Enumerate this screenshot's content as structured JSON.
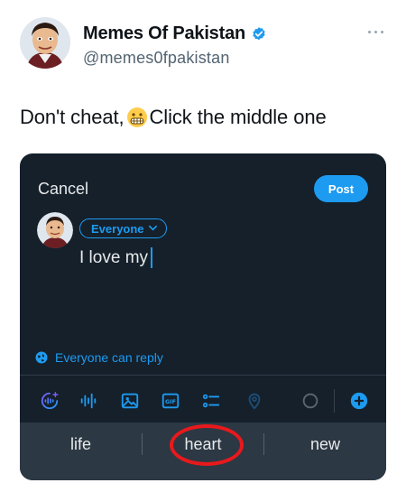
{
  "tweet": {
    "author_name": "Memes Of Pakistan",
    "author_handle": "@memes0fpakistan",
    "text_before_emoji": "Don't cheat,",
    "emoji_name": "grimacing-face-emoji",
    "text_after_emoji": "Click the middle one",
    "accent_color": "#1d9bf0"
  },
  "composer": {
    "cancel_label": "Cancel",
    "post_label": "Post",
    "audience_label": "Everyone",
    "draft_text": "I love my",
    "reply_setting": "Everyone can reply",
    "toolbar_icons": [
      "grok-icon",
      "voice-icon",
      "image-icon",
      "gif-icon",
      "poll-icon",
      "location-icon",
      "progress-ring-icon",
      "add-icon"
    ],
    "background_color": "#15202b"
  },
  "keyboard": {
    "suggestions": [
      "life",
      "heart",
      "new"
    ],
    "highlighted": "heart"
  }
}
